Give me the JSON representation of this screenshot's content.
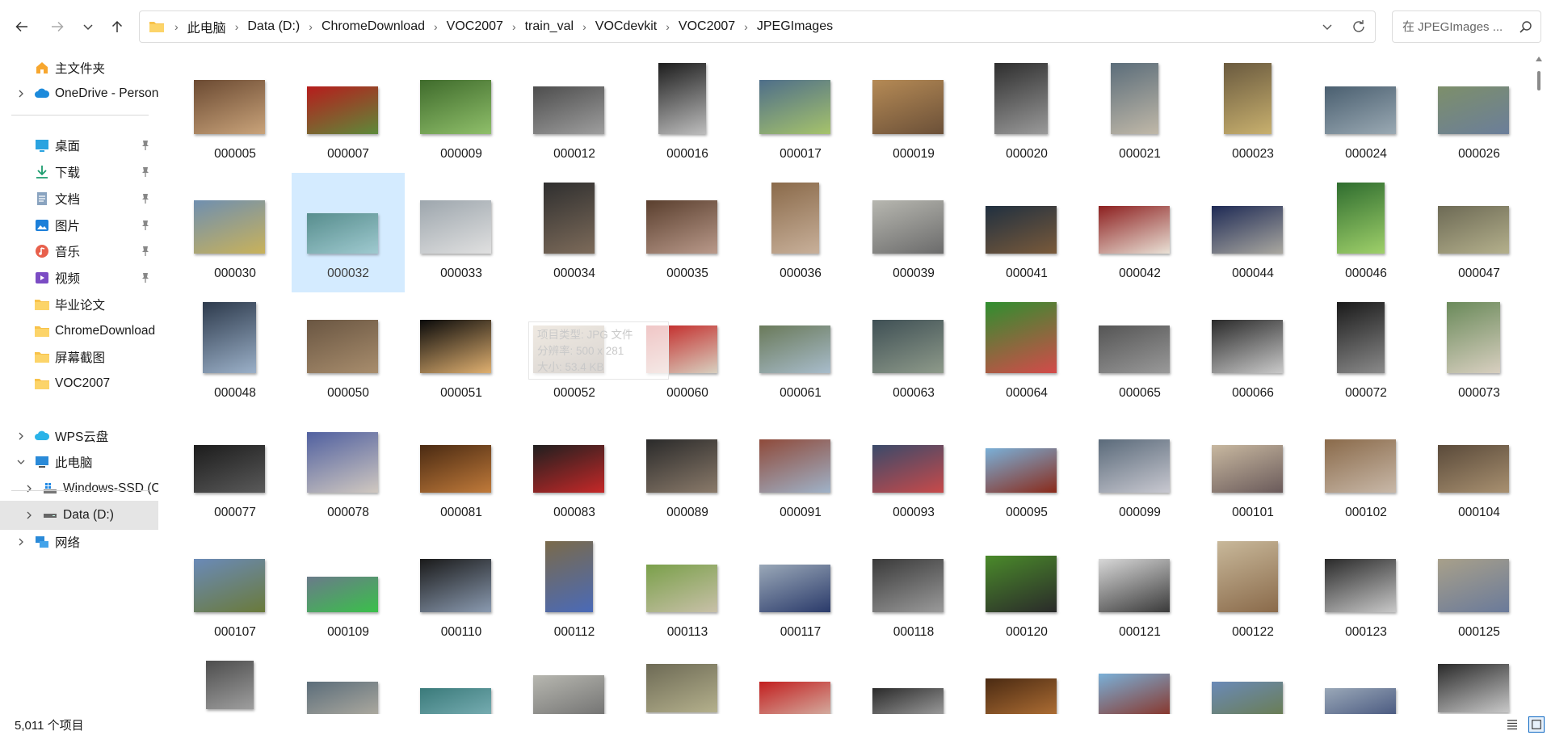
{
  "nav": {
    "back_label": "Back",
    "forward_label": "Forward",
    "recent_label": "Recent locations",
    "up_label": "Up"
  },
  "address": {
    "crumbs": [
      "此电脑",
      "Data (D:)",
      "ChromeDownload",
      "VOC2007",
      "train_val",
      "VOCdevkit",
      "VOC2007",
      "JPEGImages"
    ]
  },
  "search": {
    "placeholder": "在 JPEGImages ..."
  },
  "sidebar": {
    "items": [
      {
        "label": "主文件夹",
        "icon": "home-icon",
        "pinned": false,
        "expander": false
      },
      {
        "label": "OneDrive - Person",
        "icon": "cloud-icon",
        "pinned": false,
        "expander": true
      },
      {
        "label": "桌面",
        "icon": "desktop-icon",
        "pinned": true,
        "expander": false
      },
      {
        "label": "下载",
        "icon": "download-icon",
        "pinned": true,
        "expander": false
      },
      {
        "label": "文档",
        "icon": "document-icon",
        "pinned": true,
        "expander": false
      },
      {
        "label": "图片",
        "icon": "pictures-icon",
        "pinned": true,
        "expander": false
      },
      {
        "label": "音乐",
        "icon": "music-icon",
        "pinned": true,
        "expander": false
      },
      {
        "label": "视频",
        "icon": "video-icon",
        "pinned": true,
        "expander": false
      },
      {
        "label": "毕业论文",
        "icon": "folder-icon",
        "pinned": false,
        "expander": false
      },
      {
        "label": "ChromeDownload",
        "icon": "folder-icon",
        "pinned": false,
        "expander": false
      },
      {
        "label": "屏幕截图",
        "icon": "folder-icon",
        "pinned": false,
        "expander": false
      },
      {
        "label": "VOC2007",
        "icon": "folder-icon",
        "pinned": false,
        "expander": false
      },
      {
        "label": "WPS云盘",
        "icon": "wps-cloud-icon",
        "pinned": false,
        "expander": true
      },
      {
        "label": "此电脑",
        "icon": "this-pc-icon",
        "pinned": false,
        "expander": true,
        "expanded": true
      },
      {
        "label": "Windows-SSD (C",
        "icon": "drive-c-icon",
        "pinned": false,
        "expander": true
      },
      {
        "label": "Data (D:)",
        "icon": "drive-d-icon",
        "pinned": false,
        "expander": true,
        "selected": true
      },
      {
        "label": "网络",
        "icon": "network-icon",
        "pinned": false,
        "expander": true
      }
    ]
  },
  "files": [
    "000005",
    "000007",
    "000009",
    "000012",
    "000016",
    "000017",
    "000019",
    "000020",
    "000021",
    "000023",
    "000024",
    "000026",
    "000030",
    "000032",
    "000033",
    "000034",
    "000035",
    "000036",
    "000039",
    "000041",
    "000042",
    "000044",
    "000046",
    "000047",
    "000048",
    "000050",
    "000051",
    "000052",
    "000060",
    "000061",
    "000063",
    "000064",
    "000065",
    "000066",
    "000072",
    "000073",
    "000077",
    "000078",
    "000081",
    "000083",
    "000089",
    "000091",
    "000093",
    "000095",
    "000099",
    "000101",
    "000102",
    "000104",
    "000107",
    "000109",
    "000110",
    "000112",
    "000113",
    "000117",
    "000118",
    "000120",
    "000121",
    "000122",
    "000123",
    "000125"
  ],
  "selected_file": "000032",
  "tooltip": {
    "line1": "项目类型: JPG 文件",
    "line2": "分辨率: 500 x 281",
    "line3": "大小: 53.4 KB"
  },
  "status": {
    "item_count": "5,011 个项目"
  },
  "colors": {
    "selection": "#cde8ff",
    "sidebar_selected": "#e5e5e5",
    "folder": "#f8c24a",
    "accent": "#0a66c2"
  }
}
